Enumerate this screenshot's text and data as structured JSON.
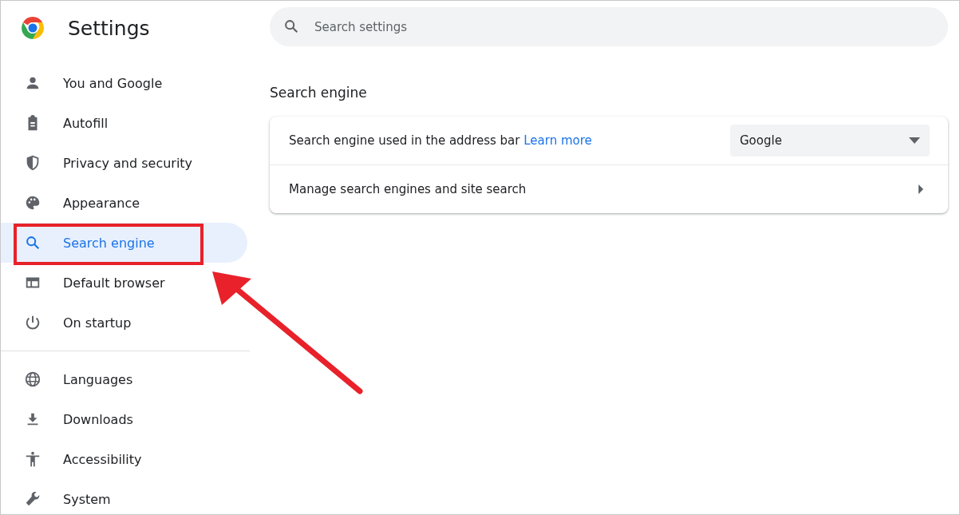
{
  "header": {
    "title": "Settings"
  },
  "search": {
    "placeholder": "Search settings"
  },
  "sidebar": {
    "sections": [
      [
        {
          "label": "You and Google",
          "kind": "person",
          "selected": false
        },
        {
          "label": "Autofill",
          "kind": "clipboard",
          "selected": false
        },
        {
          "label": "Privacy and security",
          "kind": "shield",
          "selected": false
        },
        {
          "label": "Appearance",
          "kind": "palette",
          "selected": false
        },
        {
          "label": "Search engine",
          "kind": "search",
          "selected": true
        },
        {
          "label": "Default browser",
          "kind": "browser",
          "selected": false
        },
        {
          "label": "On startup",
          "kind": "power",
          "selected": false
        }
      ],
      [
        {
          "label": "Languages",
          "kind": "globe",
          "selected": false
        },
        {
          "label": "Downloads",
          "kind": "download",
          "selected": false
        },
        {
          "label": "Accessibility",
          "kind": "accessibility",
          "selected": false
        },
        {
          "label": "System",
          "kind": "wrench",
          "selected": false
        }
      ]
    ]
  },
  "section": {
    "title": "Search engine",
    "rows": [
      {
        "kind": "select",
        "label": "Search engine used in the address bar",
        "link": "Learn more",
        "value": "Google"
      },
      {
        "kind": "link",
        "label": "Manage search engines and site search"
      }
    ]
  }
}
